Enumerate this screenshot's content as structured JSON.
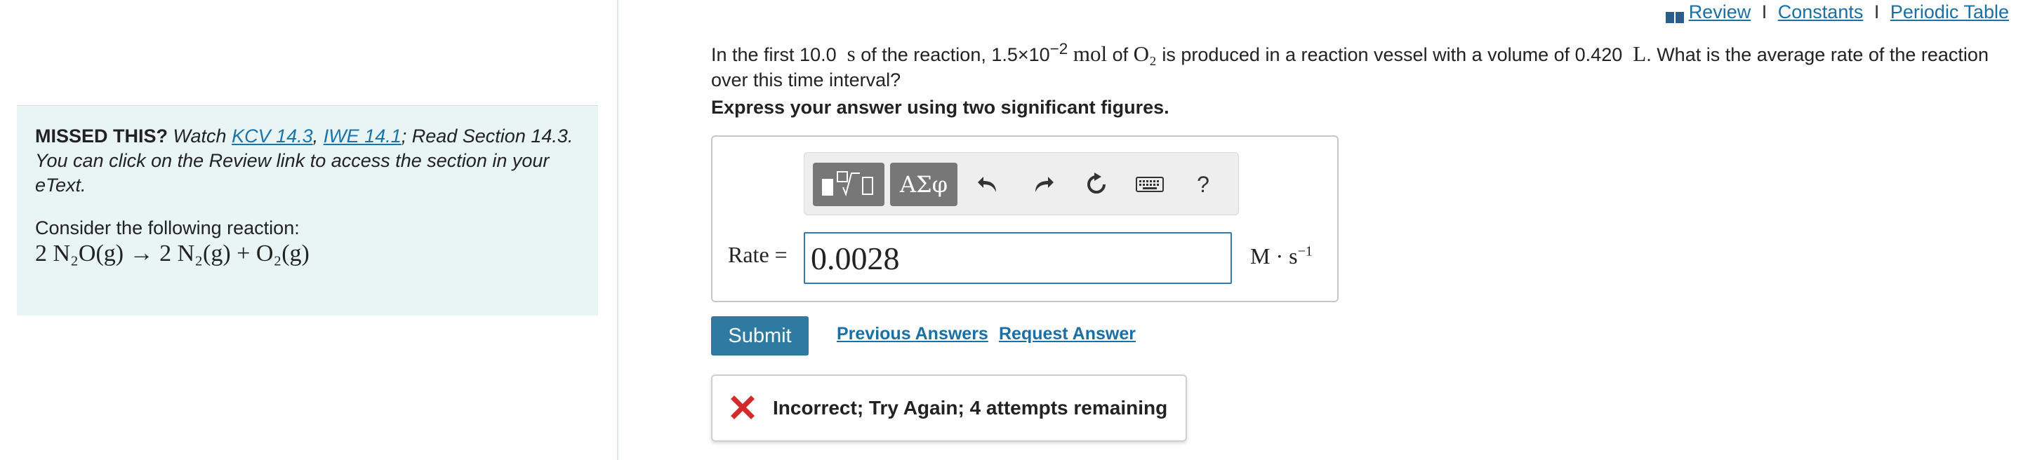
{
  "colors": {
    "accent": "#2e7aa1",
    "link": "#1a6fa5",
    "error": "#d22b2b",
    "panel_bg": "#e8f5f4"
  },
  "top_links": {
    "review": "Review",
    "constants": "Constants",
    "periodic_table": "Periodic Table",
    "separator": "I",
    "review_icon": "book-icon"
  },
  "hint_panel": {
    "missed_label": "MISSED THIS?",
    "watch_text": "Watch",
    "kcv_link": "KCV 14.3",
    "comma": ",",
    "iwe_link": "IWE 14.1",
    "read_text": "; Read Section 14.3. You can click on the Review link to access the section in your eText.",
    "consider_text": "Consider the following reaction:",
    "reaction": "2 N₂O(g) → 2 N₂(g) + O₂(g)"
  },
  "question": {
    "part1": "In the first 10.0",
    "unit_s": "s",
    "part2": "of the reaction, 1.5×10",
    "exponent": "−2",
    "unit_mol": "mol",
    "part3": "of",
    "o2": "O₂",
    "part4": "is produced in a reaction vessel with a volume of 0.420",
    "unit_l": "L",
    "part5": ". What is the average rate of the reaction over this time interval?"
  },
  "instruction": "Express your answer using two significant figures.",
  "answer": {
    "toolbar": {
      "templates_icon": "templates-icon",
      "greek_label": "ΑΣφ",
      "undo_icon": "undo-icon",
      "redo_icon": "redo-icon",
      "reset_icon": "reset-icon",
      "keyboard_icon": "keyboard-icon",
      "help_label": "?"
    },
    "rate_label": "Rate =",
    "value": "0.0028",
    "units": "M · s",
    "units_exponent": "−1"
  },
  "actions": {
    "submit": "Submit",
    "previous_answers": "Previous Answers",
    "request_answer": "Request Answer"
  },
  "feedback": {
    "icon": "x-icon",
    "message": "Incorrect; Try Again; 4 attempts remaining"
  }
}
